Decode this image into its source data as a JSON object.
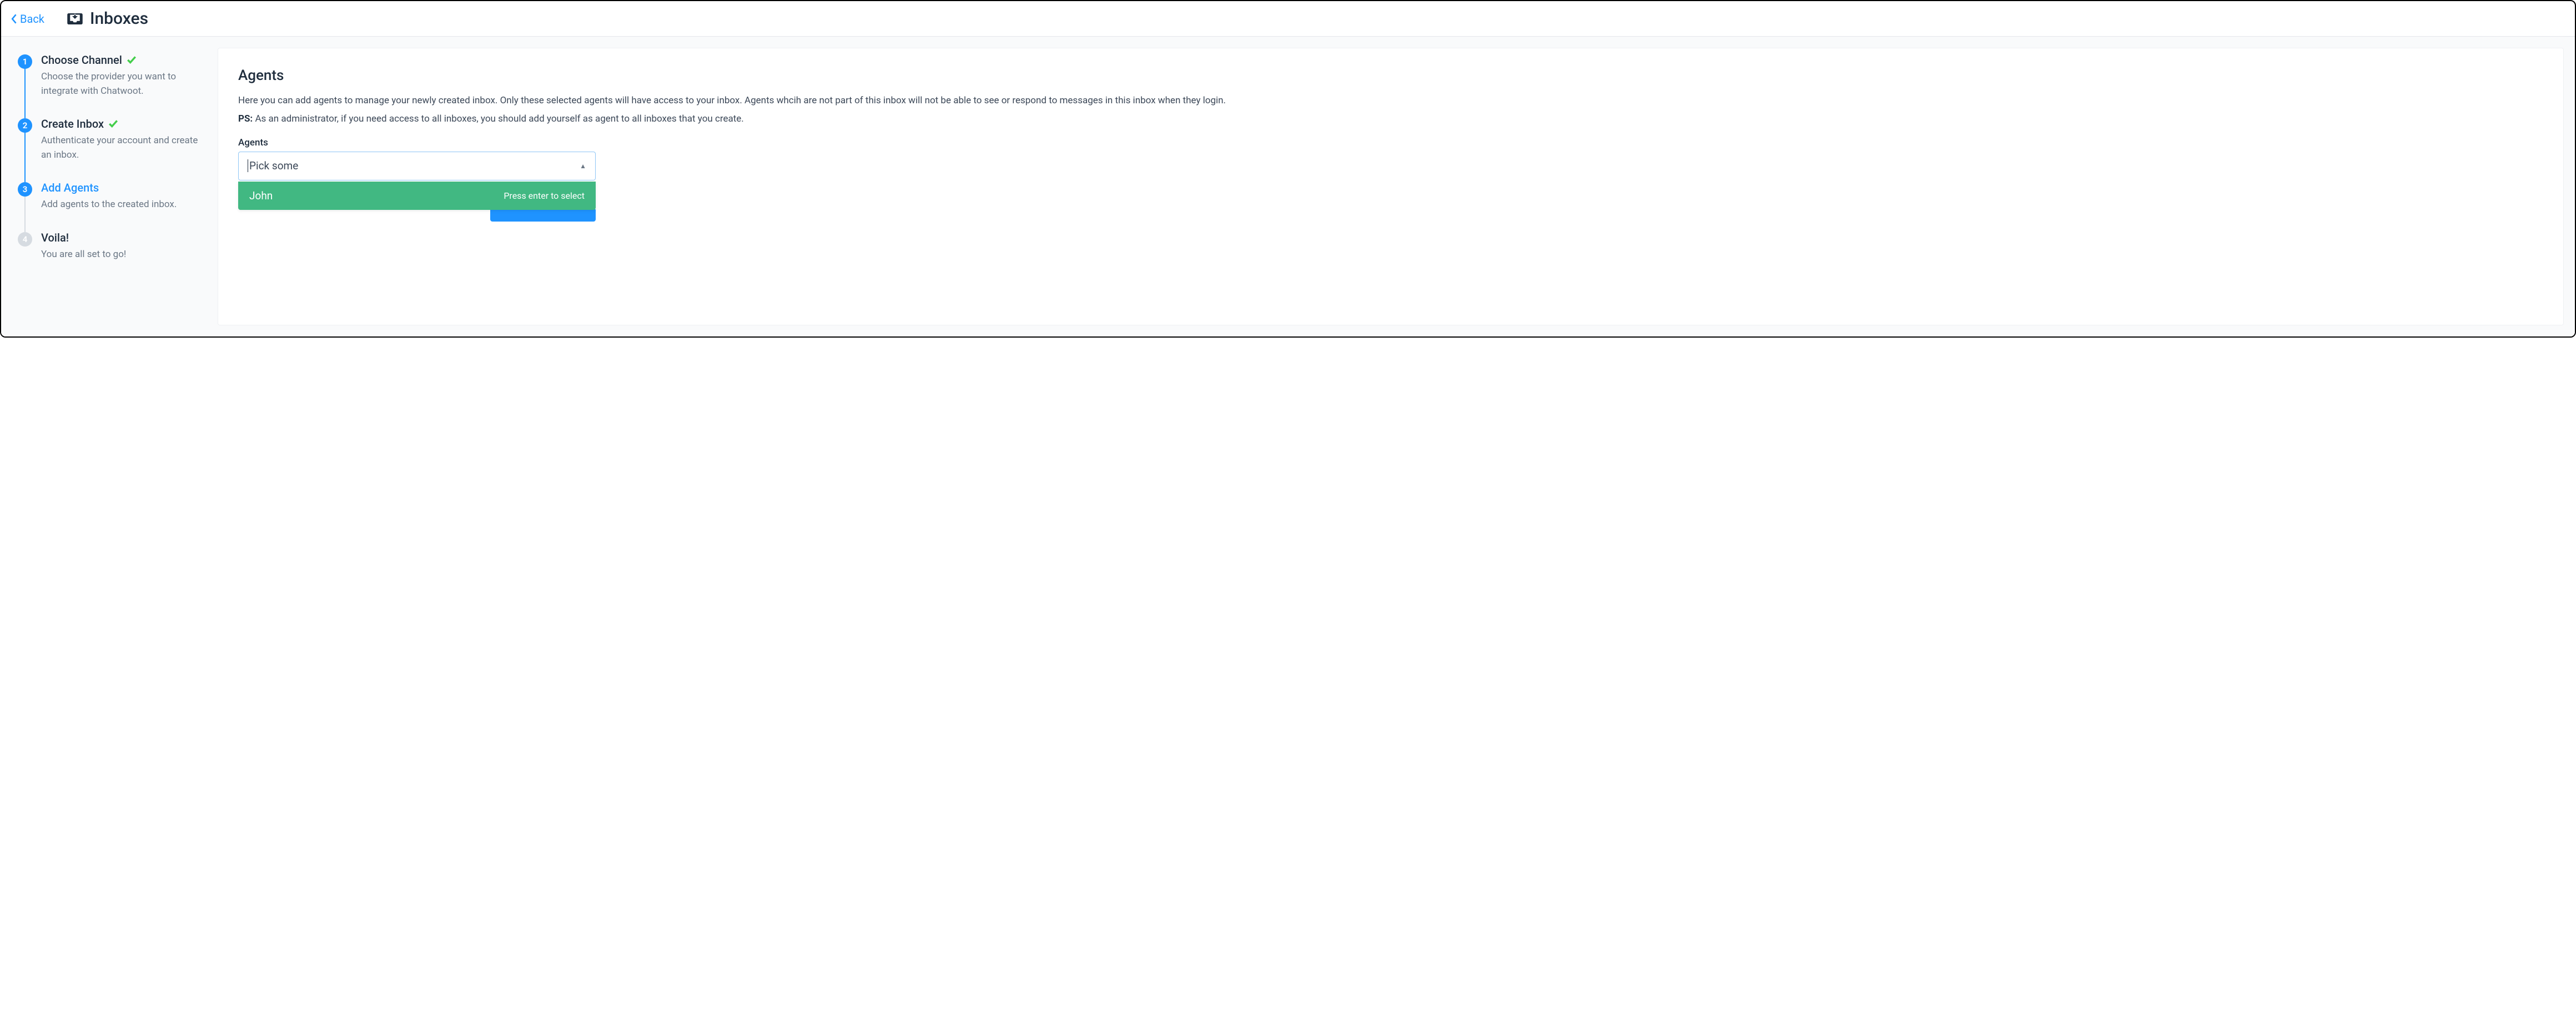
{
  "header": {
    "back_label": "Back",
    "title": "Inboxes"
  },
  "steps": [
    {
      "num": "1",
      "title": "Choose Channel",
      "desc": "Choose the provider you want to integrate with Chatwoot.",
      "done": true,
      "active": false
    },
    {
      "num": "2",
      "title": "Create Inbox",
      "desc": "Authenticate your account and create an inbox.",
      "done": true,
      "active": false
    },
    {
      "num": "3",
      "title": "Add Agents",
      "desc": "Add agents to the created inbox.",
      "done": false,
      "active": true
    },
    {
      "num": "4",
      "title": "Voila!",
      "desc": "You are all set to go!",
      "done": false,
      "active": false,
      "inactive": true
    }
  ],
  "main": {
    "title": "Agents",
    "desc_line1": "Here you can add agents to manage your newly created inbox. Only these selected agents will have access to your inbox. Agents whcih are not part of this inbox will not be able to see or respond to messages in this inbox when they login.",
    "ps_label": "PS:",
    "ps_text": "As an administrator, if you need access to all inboxes, you should add yourself as agent to all inboxes that you create.",
    "field_label": "Agents",
    "select_placeholder": "Pick some",
    "dropdown_option": "John",
    "dropdown_hint": "Press enter to select"
  }
}
